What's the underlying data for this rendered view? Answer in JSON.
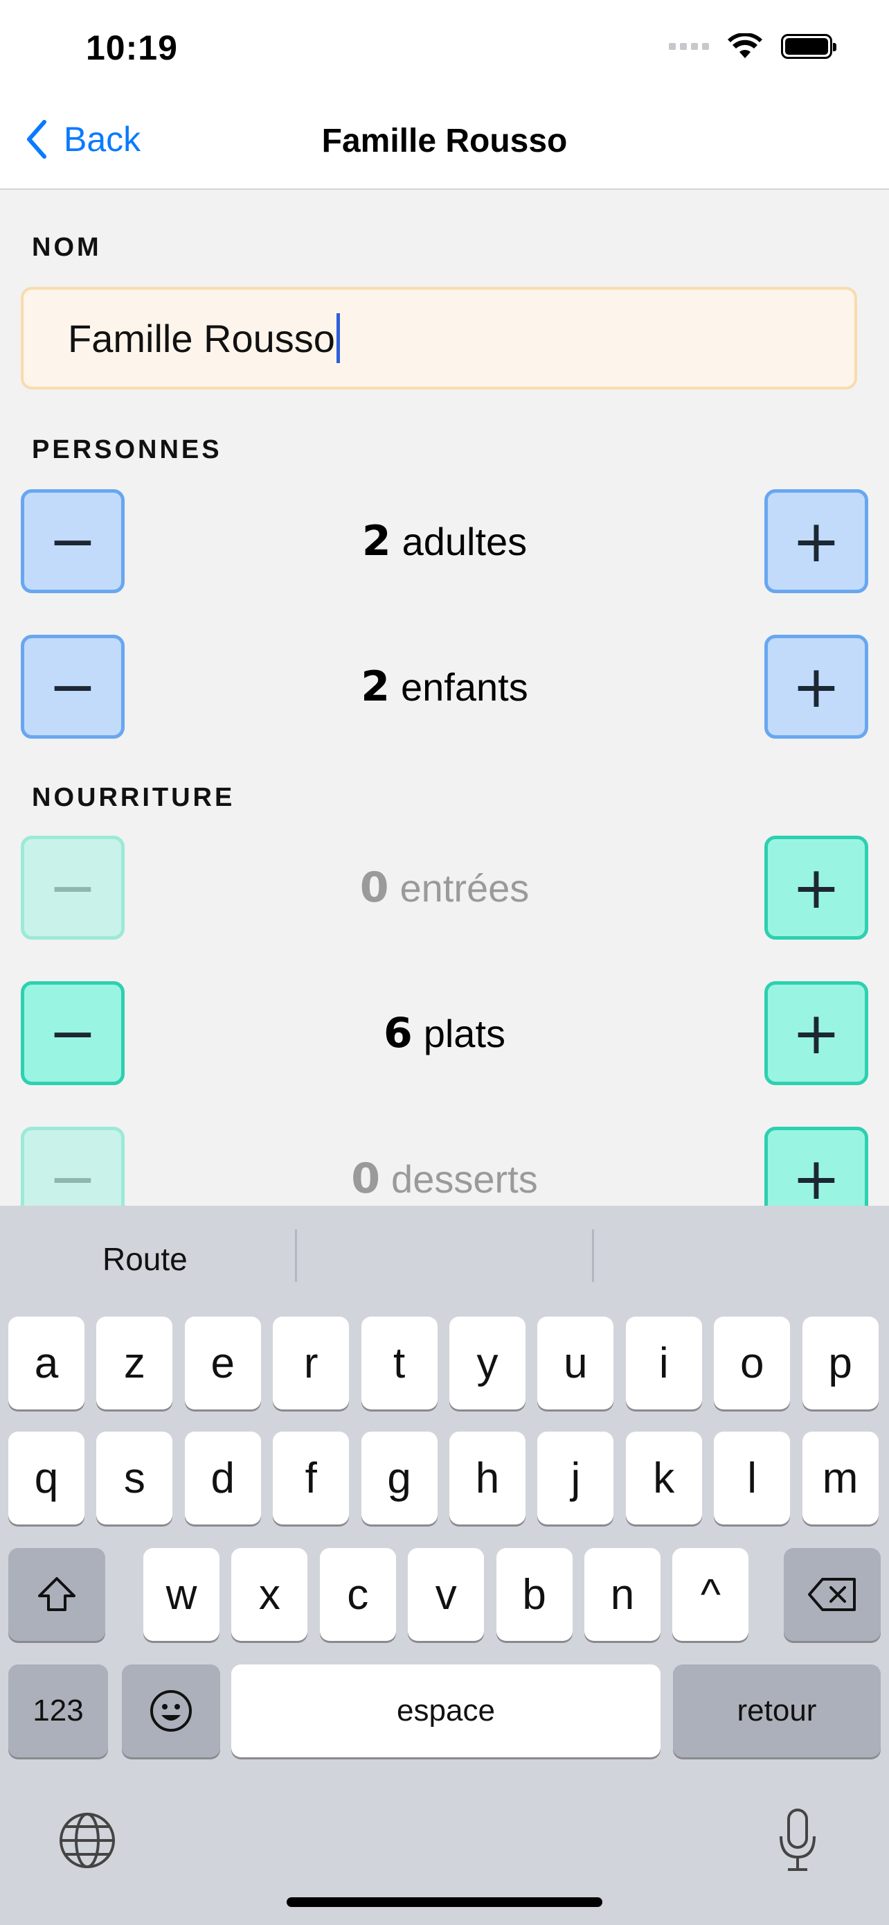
{
  "status_bar": {
    "time": "10:19"
  },
  "nav": {
    "back_label": "Back",
    "title": "Famille Rousso"
  },
  "form": {
    "name_label": "NOM",
    "name_value": "Famille Rousso",
    "people_label": "PERSONNES",
    "food_label": "NOURRITURE",
    "adults": {
      "count": "2",
      "unit": "adultes"
    },
    "children": {
      "count": "2",
      "unit": "enfants"
    },
    "starters": {
      "count": "0",
      "unit": "entrées"
    },
    "mains": {
      "count": "6",
      "unit": "plats"
    },
    "desserts": {
      "count": "0",
      "unit": "desserts"
    },
    "minus_glyph": "−",
    "plus_glyph": "+"
  },
  "keyboard": {
    "suggestion": "Route",
    "row1": [
      "a",
      "z",
      "e",
      "r",
      "t",
      "y",
      "u",
      "i",
      "o",
      "p"
    ],
    "row2": [
      "q",
      "s",
      "d",
      "f",
      "g",
      "h",
      "j",
      "k",
      "l",
      "m"
    ],
    "row3": [
      "w",
      "x",
      "c",
      "v",
      "b",
      "n",
      "^"
    ],
    "numbers_label": "123",
    "space_label": "espace",
    "return_label": "retour"
  },
  "icons": {
    "back": "chevron-left-icon",
    "wifi": "wifi-icon",
    "battery": "battery-icon",
    "shift": "shift-icon",
    "delete": "delete-icon",
    "emoji": "emoji-icon",
    "globe": "globe-icon",
    "mic": "microphone-icon"
  },
  "colors": {
    "accent": "#0a7aff",
    "people_button": "#c2dbfb",
    "food_button": "#9af4e2",
    "name_field": "#fdf5ec"
  }
}
